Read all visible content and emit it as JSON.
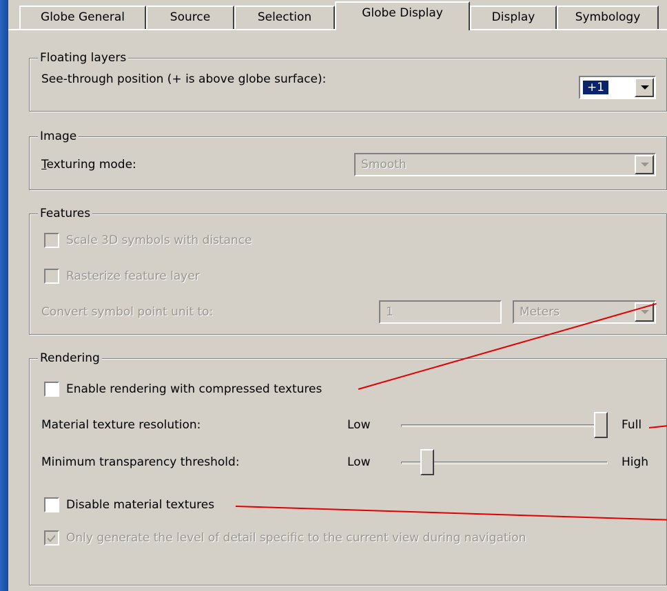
{
  "tabs": [
    {
      "label": "Globe General"
    },
    {
      "label": "Source"
    },
    {
      "label": "Selection"
    },
    {
      "label": "Globe Display"
    },
    {
      "label": "Display"
    },
    {
      "label": "Symbology"
    }
  ],
  "active_tab": "Globe Display",
  "floating_layers": {
    "legend": "Floating layers",
    "see_through_label": "See-through position (+ is above globe surface):",
    "see_through_value": "+1"
  },
  "image": {
    "legend": "Image",
    "texturing_label": "Texturing mode:",
    "texturing_value": "Smooth"
  },
  "features": {
    "legend": "Features",
    "scale_3d_label": "Scale 3D symbols with distance",
    "rasterize_label": "Rasterize feature layer",
    "convert_label": "Convert symbol point unit to:",
    "convert_value": "1",
    "unit_value": "Meters"
  },
  "rendering": {
    "legend": "Rendering",
    "compressed_label": "Enable rendering with compressed textures",
    "material_res_label": "Material texture resolution:",
    "material_res_min": "Low",
    "material_res_max": "Full",
    "material_res_level": 1.0,
    "min_transp_label": "Minimum transparency threshold:",
    "min_transp_min": "Low",
    "min_transp_max": "High",
    "min_transp_level": 0.1,
    "disable_label": "Disable material textures",
    "lod_label": "Only generate the level of detail specific to the current view during navigation",
    "lod_checked": true
  },
  "colors": {
    "dialog_bg": "#d4d0c8",
    "desktop_bg": "#1d57b5",
    "annotation_line": "#e00000",
    "selection_bg": "#0a246a"
  }
}
